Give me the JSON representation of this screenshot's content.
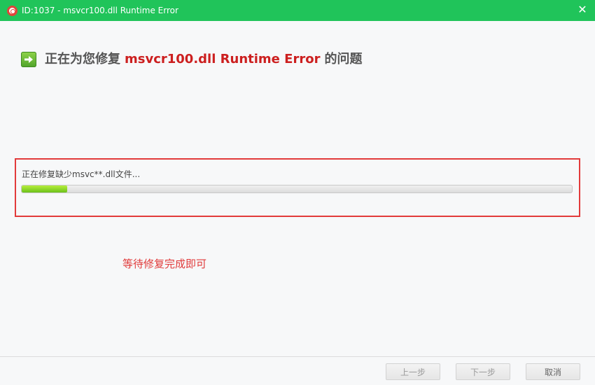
{
  "window": {
    "title": "ID:1037 - msvcr100.dll Runtime Error"
  },
  "heading": {
    "prefix": "正在为您修复",
    "error_name": "msvcr100.dll Runtime Error",
    "suffix": "的问题"
  },
  "progress": {
    "label": "正在修复缺少msvc**.dll文件...",
    "fraction": 0.083
  },
  "hint": "等待修复完成即可",
  "buttons": {
    "prev": "上一步",
    "next": "下一步",
    "cancel": "取消"
  },
  "icons": {
    "app": "lifebuoy-icon",
    "close": "close-icon",
    "heading": "arrow-right-icon"
  },
  "colors": {
    "titlebar": "#20c45a",
    "error_text": "#cc1f1f",
    "highlight_border": "#e23b3b",
    "progress_fill": "#8ad62a"
  }
}
